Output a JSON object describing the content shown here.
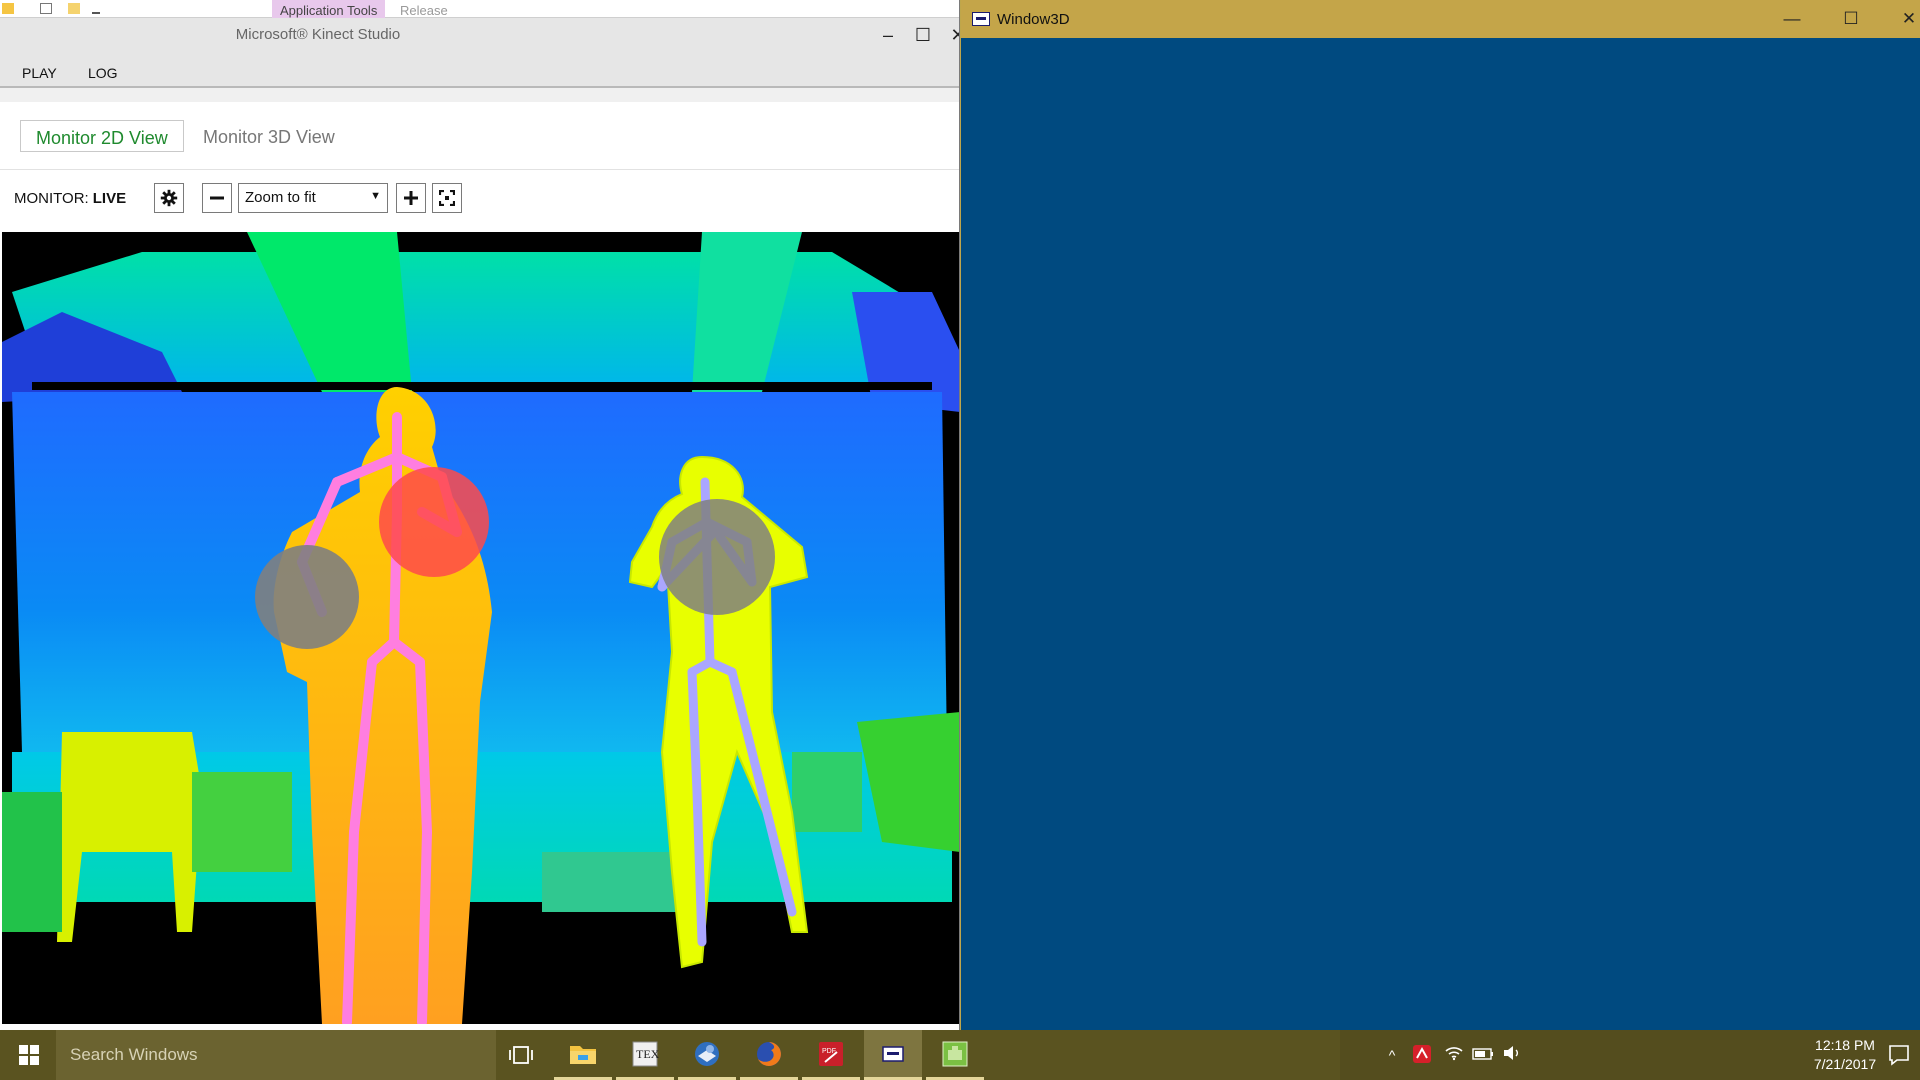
{
  "explorer_ribbon": {
    "context_tab": "Application Tools",
    "tab_release": "Release"
  },
  "kinect_studio": {
    "title": "Microsoft® Kinect Studio",
    "window_controls": {
      "minimize": "–",
      "maximize": "☐",
      "close": "✕"
    },
    "menu": [
      {
        "label": "PLAY"
      },
      {
        "label": "LOG"
      }
    ],
    "view_tabs": [
      {
        "label": "Monitor 2D View",
        "active": true
      },
      {
        "label": "Monitor 3D View",
        "active": false
      }
    ],
    "monitor": {
      "label": "MONITOR:",
      "state": "LIVE"
    },
    "toolbar": {
      "settings_icon": "gear-icon",
      "zoom_out_icon": "minus-icon",
      "zoom_value": "Zoom to fit",
      "zoom_in_icon": "plus-icon",
      "fullscreen_icon": "expand-icon"
    },
    "depth_view": {
      "bodies": [
        {
          "color": "#ff7ee0",
          "left_hand_state": "closed",
          "right_hand_state": "neutral"
        },
        {
          "color": "#aaa6ff",
          "left_hand_state": "neutral",
          "right_hand_state": "neutral"
        }
      ],
      "hand_state_colors": {
        "closed": "#ff4a4a",
        "neutral": "#808080"
      }
    }
  },
  "window3d": {
    "title": "Window3D",
    "window_controls": {
      "minimize": "—",
      "maximize": "☐",
      "close": "✕"
    },
    "background": "#004a80"
  },
  "taskbar": {
    "search_placeholder": "Search Windows",
    "apps": [
      {
        "name": "task-view"
      },
      {
        "name": "file-explorer",
        "running": true
      },
      {
        "name": "tex-editor",
        "running": true
      },
      {
        "name": "thunderbird",
        "running": true
      },
      {
        "name": "firefox",
        "running": true
      },
      {
        "name": "pdf-reader",
        "running": true
      },
      {
        "name": "window3d-app",
        "running": true,
        "active": true
      },
      {
        "name": "kinect-studio",
        "running": true
      }
    ],
    "clock": {
      "time": "12:18 PM",
      "date": "7/21/2017"
    },
    "colors": {
      "bar": "#5a5320",
      "accent": "#c4a549"
    }
  }
}
